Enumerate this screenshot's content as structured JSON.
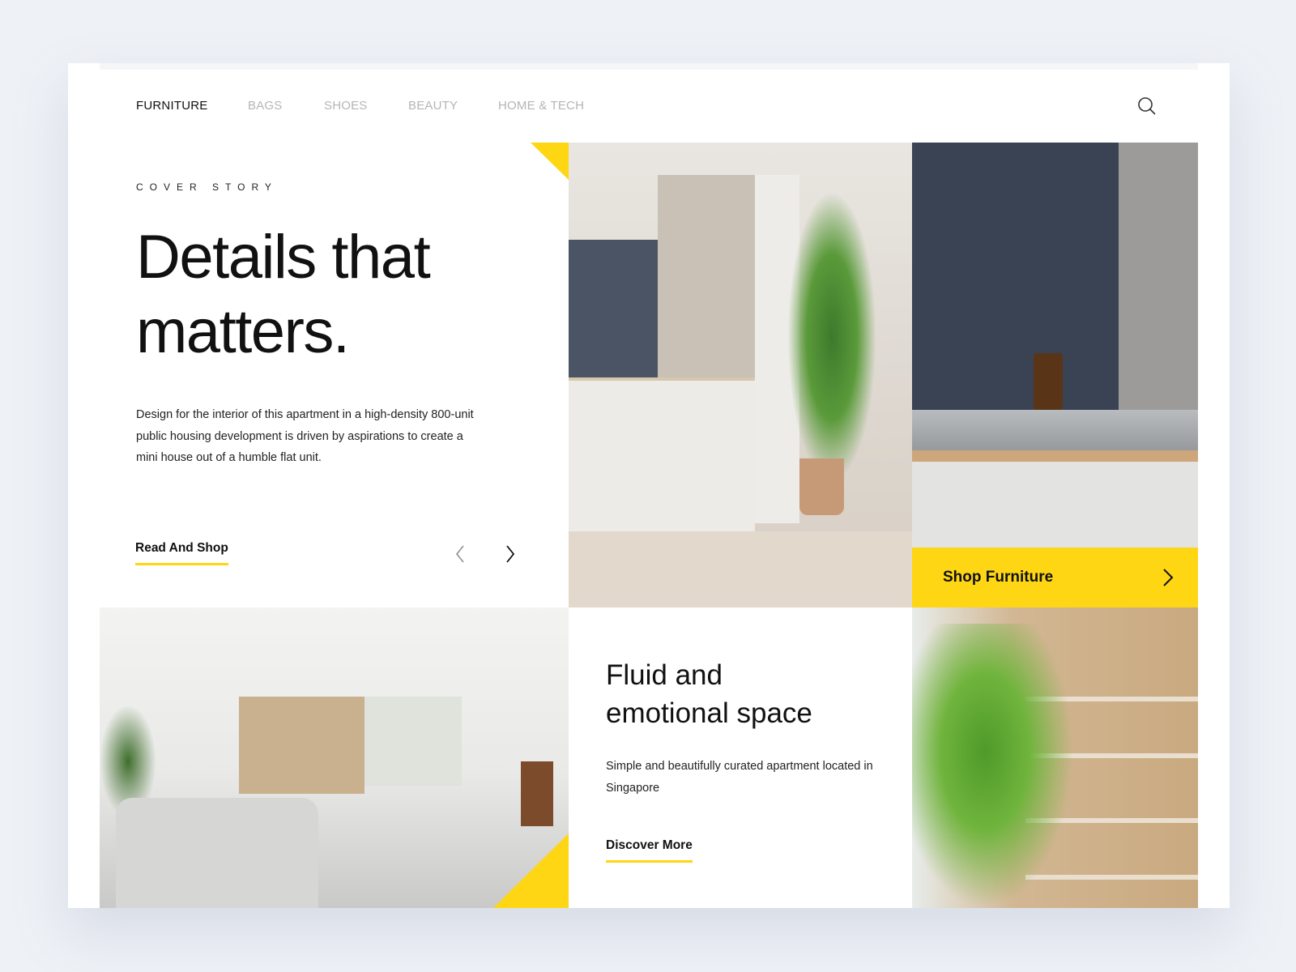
{
  "nav": {
    "items": [
      "FURNITURE",
      "BAGS",
      "SHOES",
      "BEAUTY",
      "HOME & TECH"
    ],
    "active": "FURNITURE",
    "search_icon": "search-icon"
  },
  "hero": {
    "eyebrow": "COVER STORY",
    "title_line1": "Details that",
    "title_line2": "matters.",
    "description": "Design for the interior of this apartment in a high-density 800-unit public housing development is driven by aspirations to create a mini house out of a humble flat unit.",
    "cta": "Read And Shop",
    "prev_icon": "chevron-left-icon",
    "next_icon": "chevron-right-icon"
  },
  "shop": {
    "label": "Shop Furniture",
    "icon": "chevron-right-icon"
  },
  "feature": {
    "title_line1": "Fluid and",
    "title_line2": "emotional space",
    "description": "Simple and beautifully curated apartment located in Singapore",
    "cta": "Discover More"
  },
  "colors": {
    "accent": "#ffd614",
    "background": "#eef1f6",
    "text": "#111111"
  }
}
